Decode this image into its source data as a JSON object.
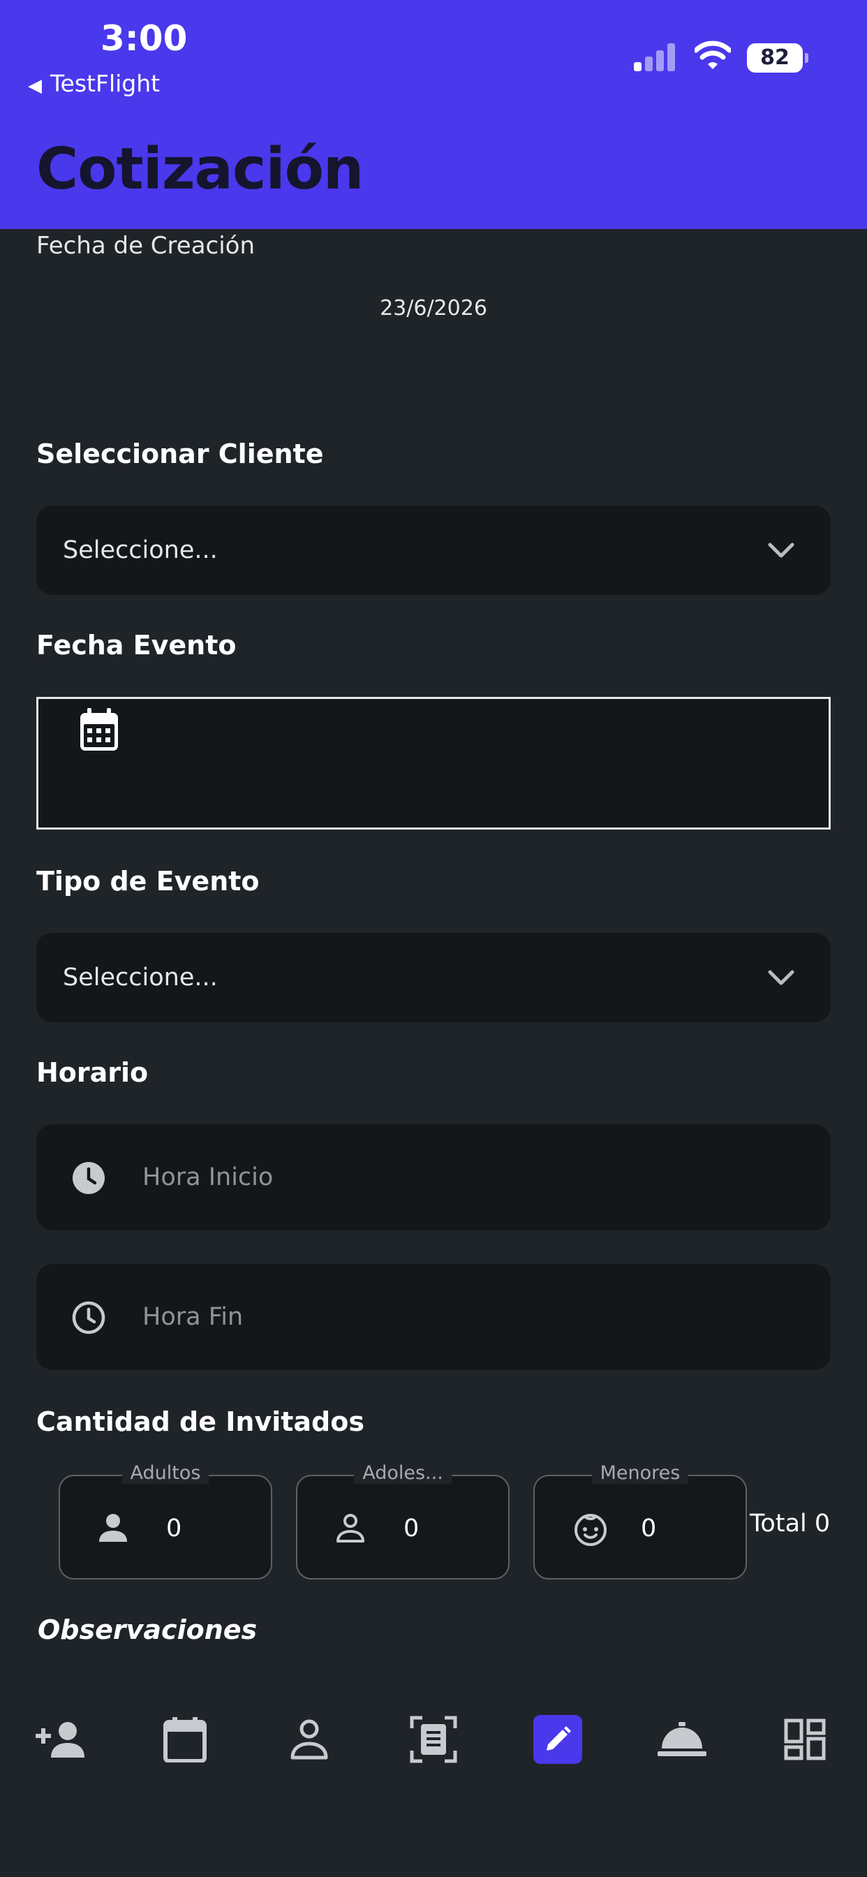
{
  "status_bar": {
    "time": "3:00",
    "back_label": "TestFlight",
    "battery": "82"
  },
  "header": {
    "title": "Cotización"
  },
  "creation": {
    "label": "Fecha de Creación",
    "value": "23/6/2026"
  },
  "client": {
    "title": "Seleccionar Cliente",
    "placeholder": "Seleccione..."
  },
  "event_date": {
    "title": "Fecha Evento"
  },
  "event_type": {
    "title": "Tipo de Evento",
    "placeholder": "Seleccione..."
  },
  "schedule": {
    "title": "Horario",
    "start_placeholder": "Hora Inicio",
    "end_placeholder": "Hora Fin"
  },
  "guests": {
    "title": "Cantidad de Invitados",
    "cards": [
      {
        "label": "Adultos",
        "value": "0",
        "icon": "person-icon"
      },
      {
        "label": "Adoles...",
        "value": "0",
        "icon": "person-outline-icon"
      },
      {
        "label": "Menores",
        "value": "0",
        "icon": "child-face-icon"
      }
    ],
    "total": "Total 0"
  },
  "observations": {
    "title": "Observaciones"
  },
  "bottom_nav": {
    "items": [
      {
        "icon": "add-person-icon"
      },
      {
        "icon": "calendar-icon"
      },
      {
        "icon": "person-icon"
      },
      {
        "icon": "document-scan-icon"
      },
      {
        "icon": "edit-icon",
        "active": true
      },
      {
        "icon": "room-service-icon"
      },
      {
        "icon": "dashboard-icon"
      }
    ]
  },
  "colors": {
    "accent": "#4a38ec",
    "background": "#1f2429",
    "field": "#14171a",
    "icon_gray": "#a9adb2"
  }
}
